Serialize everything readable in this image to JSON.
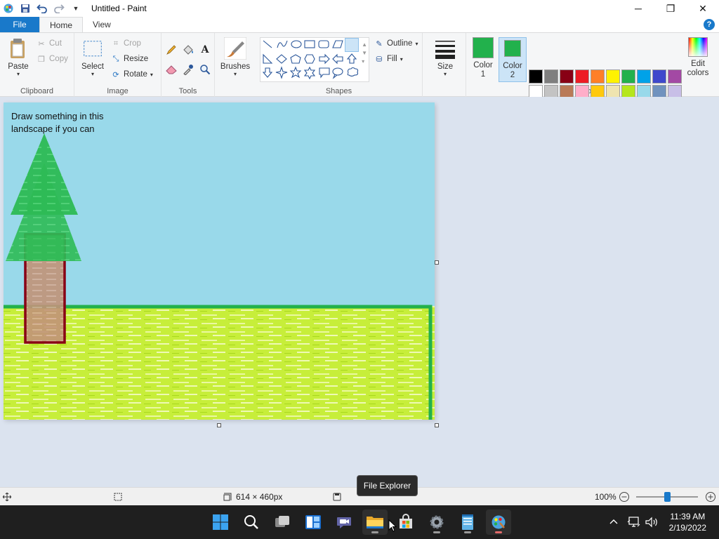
{
  "window": {
    "title": "Untitled - Paint",
    "controls": {
      "minimize": "─",
      "maximize": "❐",
      "close": "✕"
    }
  },
  "tabs": [
    {
      "label": "File"
    },
    {
      "label": "Home"
    },
    {
      "label": "View"
    }
  ],
  "help_label": "?",
  "clipboard": {
    "paste": "Paste",
    "cut": "Cut",
    "copy": "Copy",
    "group": "Clipboard"
  },
  "image": {
    "select": "Select",
    "crop": "Crop",
    "resize": "Resize",
    "rotate": "Rotate",
    "group": "Image"
  },
  "tools": {
    "group": "Tools",
    "icons": [
      "pencil-icon",
      "fill-icon",
      "text-icon",
      "eraser-icon",
      "color-picker-icon",
      "magnifier-icon"
    ]
  },
  "brushes": {
    "label": "Brushes"
  },
  "shapes": {
    "group": "Shapes",
    "outline": "Outline",
    "fill": "Fill",
    "icons": [
      "line",
      "curve",
      "oval",
      "rectangle",
      "rounded-rectangle",
      "polygon",
      "triangle",
      "right-triangle",
      "diamond",
      "pentagon",
      "hexagon",
      "right-arrow",
      "left-arrow",
      "up-arrow",
      "down-arrow",
      "four-point-star",
      "five-point-star",
      "six-point-star",
      "rounded-callout",
      "oval-callout",
      "cloud-callout"
    ]
  },
  "size": {
    "label": "Size"
  },
  "colors": {
    "group": "Colors",
    "color1": {
      "label": "Color\n1",
      "label_line1": "Color",
      "label_line2": "1",
      "value": "#22b14c"
    },
    "color2": {
      "label_line1": "Color",
      "label_line2": "2",
      "value": "#22b14c"
    },
    "edit": {
      "label_line1": "Edit",
      "label_line2": "colors"
    },
    "palette": [
      "#000000",
      "#7f7f7f",
      "#880015",
      "#ed1c24",
      "#ff7f27",
      "#fff200",
      "#22b14c",
      "#00a2e8",
      "#3f48cc",
      "#a349a4",
      "#ffffff",
      "#c3c3c3",
      "#b97a57",
      "#ffaec9",
      "#ffc90e",
      "#efe4b0",
      "#b5e61d",
      "#99d9ea",
      "#7092be",
      "#c8bfe7",
      "#ffffff",
      "#ffffff",
      "#ffffff",
      "#ffffff",
      "#ffffff",
      "#ffffff",
      "#ffffff",
      "#ffffff",
      "#ffffff",
      "#ffffff"
    ]
  },
  "canvas": {
    "text_line1": "Draw something in this",
    "text_line2": "landscape if you can",
    "sky_color": "#99d9ea",
    "grass_color": "#b5e61d",
    "grass_border": "#22b14c",
    "tree_color": "#22b14c",
    "trunk_border": "#880015"
  },
  "status": {
    "dimensions": "614 × 460px",
    "zoom": "100%"
  },
  "tooltip": {
    "text": "File Explorer"
  },
  "taskbar": {
    "icons": [
      "windows-start-icon",
      "search-icon",
      "task-view-icon",
      "widgets-icon",
      "teams-chat-icon",
      "file-explorer-icon",
      "store-icon",
      "settings-icon",
      "notepad-icon",
      "paint-icon"
    ]
  },
  "clock": {
    "time": "11:39 AM",
    "date": "2/19/2022"
  }
}
